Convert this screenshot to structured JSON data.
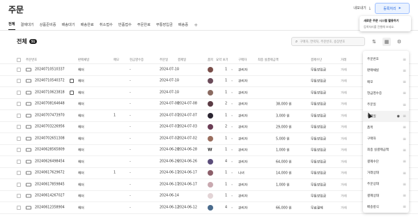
{
  "page": {
    "title": "주문",
    "export_label": "내보내기",
    "register_label": "등록처리"
  },
  "tooltip": {
    "title": "새로운 주문 시스템 활용하기",
    "subtitle": "등록처리를 진행해 보세요."
  },
  "tabs": [
    "전체",
    "결제대기",
    "상품준비중",
    "배송대기",
    "배송완료",
    "취소접수",
    "반품접수",
    "주문완료",
    "무통장입금",
    "배송중"
  ],
  "sub": {
    "title": "전체",
    "count": "51"
  },
  "search": {
    "placeholder": "구매자, 연락처, 주문번호, 송장번호"
  },
  "columns": [
    "주문번호",
    "판매채널",
    "메모",
    "현금영수증",
    "주문일",
    "결제일",
    "품목",
    "요약 보기",
    "구매자",
    "최종 실결제금액",
    "결제수단",
    "거래"
  ],
  "rows": [
    {
      "id": "20240710510337",
      "ch": "헤더",
      "memo": "",
      "cash": "-",
      "od": "2024-07-10",
      "pd": "-",
      "q": "1",
      "buyer": "관리자",
      "amt": "",
      "pay": "무통장입금",
      "st": "거래",
      "gift": false
    },
    {
      "id": "20240710540372",
      "ch": "헤더",
      "memo": "",
      "cash": "-",
      "od": "2024-07-10",
      "pd": "-",
      "q": "1",
      "buyer": "관리자",
      "amt": "",
      "pay": "무통장입금",
      "st": "거래",
      "gift": true
    },
    {
      "id": "20240710623818",
      "ch": "헤더",
      "memo": "",
      "cash": "-",
      "od": "2024-07-10",
      "pd": "-",
      "q": "1",
      "buyer": "관리자",
      "amt": "",
      "pay": "무통장입금",
      "st": "거래",
      "gift": true
    },
    {
      "id": "20240708164648",
      "ch": "헤더",
      "memo": "",
      "cash": "-",
      "od": "2024-07-08",
      "pd": "2024-07-08",
      "q": "2",
      "buyer": "관리자",
      "amt": "38,000 원",
      "pay": "무통장입금",
      "st": "거래",
      "gift": false
    },
    {
      "id": "20240707473970",
      "ch": "헤더",
      "memo": "1",
      "cash": "-",
      "od": "2024-07-07",
      "pd": "2024-07-07",
      "q": "1",
      "buyer": "관리자",
      "amt": "3,000 원",
      "pay": "무통장입금",
      "st": "거래",
      "gift": false
    },
    {
      "id": "20240703226956",
      "ch": "헤더",
      "memo": "",
      "cash": "-",
      "od": "2024-07-03",
      "pd": "2024-07-03",
      "q": "2",
      "buyer": "관리자",
      "amt": "29,000 원",
      "pay": "무통장입금",
      "st": "거래",
      "gift": false
    },
    {
      "id": "20240702651308",
      "ch": "헤더",
      "memo": "",
      "cash": "-",
      "od": "2024-07-02",
      "pd": "2024-07-02",
      "q": "1",
      "buyer": "관리자",
      "amt": "5,000 원",
      "pay": "무통장입금",
      "st": "거래",
      "gift": false
    },
    {
      "id": "20240628565809",
      "ch": "헤더",
      "memo": "",
      "cash": "-",
      "od": "2024-06-28",
      "pd": "2024-06-28",
      "q": "1",
      "buyer": "관리자",
      "amt": "1,000 원",
      "pay": "무통장입금",
      "st": "거래",
      "gift": false
    },
    {
      "id": "20240626498454",
      "ch": "헤더",
      "memo": "",
      "cash": "-",
      "od": "2024-06-26",
      "pd": "2024-06-26",
      "q": "4",
      "buyer": "관리자",
      "amt": "64,000 원",
      "pay": "무통장입금",
      "st": "거래",
      "gift": false
    },
    {
      "id": "20240617629672",
      "ch": "헤더",
      "memo": "1",
      "cash": "-",
      "od": "2024-06-17",
      "pd": "2024-06-17",
      "q": "1",
      "buyer": "나녀",
      "amt": "14,000 원",
      "pay": "무통장입금",
      "st": "거래",
      "gift": false
    },
    {
      "id": "20240617859845",
      "ch": "헤더",
      "memo": "",
      "cash": "-",
      "od": "2024-06-17",
      "pd": "2024-06-17",
      "q": "1",
      "buyer": "관리자",
      "amt": "1,000 원",
      "pay": "무통장입금",
      "st": "거래",
      "gift": false
    },
    {
      "id": "20240614267027",
      "ch": "헤더",
      "memo": "",
      "cash": "-",
      "od": "2024-06-14",
      "pd": "-",
      "q": "1",
      "buyer": "관리자",
      "amt": "",
      "pay": "무통장입금",
      "st": "거래",
      "gift": false
    },
    {
      "id": "20240612358904",
      "ch": "헤더",
      "memo": "",
      "cash": "-",
      "od": "2024-06-12",
      "pd": "2024-06-12",
      "q": "4",
      "buyer": "관리자",
      "amt": "66,000 원",
      "pay": "무료결제",
      "st": "거래",
      "gift": false
    }
  ],
  "panel_items": [
    "주문번호",
    "판매채널",
    "메모",
    "현금영수증",
    "주문일",
    "결제일",
    "품목",
    "구매자",
    "최종 실결제금액",
    "결제수단",
    "거래상태",
    "주문상태",
    "결제상태",
    "배송방식"
  ]
}
